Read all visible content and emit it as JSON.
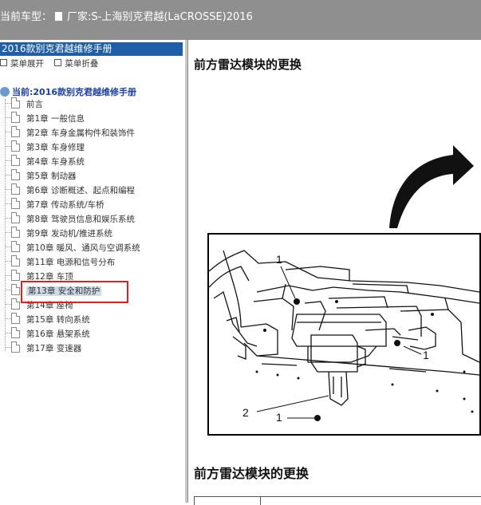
{
  "header": {
    "model_label": "当前车型：",
    "model_value": "厂家:S-上海别克君越(LaCROSSE)2016"
  },
  "sidebar": {
    "manual_title": "2016款别克君越维修手册",
    "expand_label": "菜单展开",
    "collapse_label": "菜单折叠",
    "root_label": "当前:2016款别克君越维修手册",
    "items": [
      {
        "label": "前言"
      },
      {
        "label": "第1章 一般信息"
      },
      {
        "label": "第2章 车身金属构件和装饰件"
      },
      {
        "label": "第3章 车身修理"
      },
      {
        "label": "第4章 车身系统"
      },
      {
        "label": "第5章 制动器"
      },
      {
        "label": "第6章 诊断概述、起点和编程"
      },
      {
        "label": "第7章 传动系统/车桥"
      },
      {
        "label": "第8章 驾驶员信息和娱乐系统"
      },
      {
        "label": "第9章 发动机/推进系统"
      },
      {
        "label": "第10章 暖风、通风与空调系统"
      },
      {
        "label": "第11章 电源和信号分布"
      },
      {
        "label": "第12章 车顶"
      },
      {
        "label": "第13章 安全和防护",
        "selected": true
      },
      {
        "label": "第14章 座椅"
      },
      {
        "label": "第15章 转向系统"
      },
      {
        "label": "第16章 悬架系统"
      },
      {
        "label": "第17章 变速器"
      }
    ]
  },
  "content": {
    "title": "前方雷达模块的更换",
    "subtitle": "前方雷达模块的更换",
    "callouts": [
      "1",
      "1",
      "1",
      "2"
    ]
  },
  "colors": {
    "topbar": "#8f8f8f",
    "manual_header": "#1f5fa8",
    "root_text": "#1a3fa0",
    "selection_outline": "#e02020",
    "selected_bg": "#cfdbe9"
  }
}
